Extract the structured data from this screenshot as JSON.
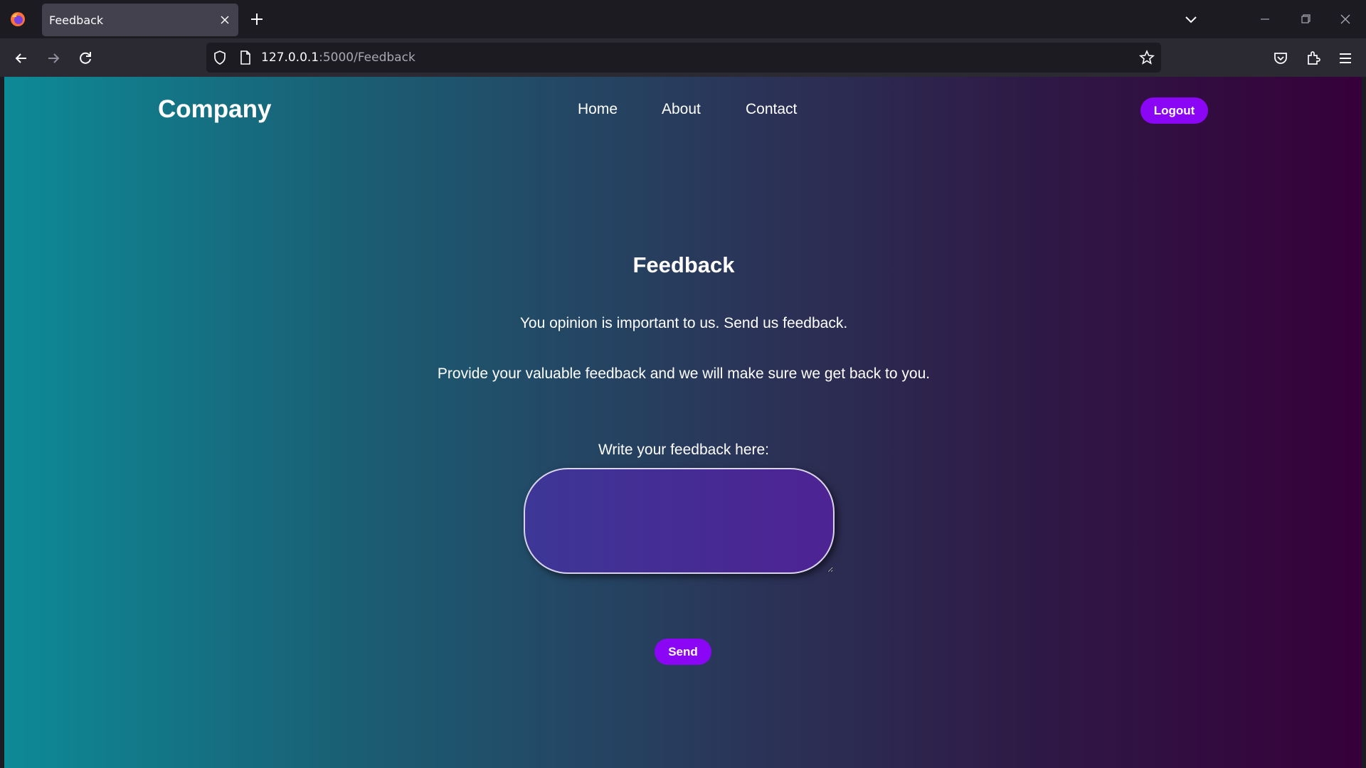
{
  "browser": {
    "tab_title": "Feedback",
    "url_host": "127.0.0.1",
    "url_path": ":5000/Feedback"
  },
  "page": {
    "brand": "Company",
    "nav": [
      "Home",
      "About",
      "Contact"
    ],
    "logout_label": "Logout",
    "title": "Feedback",
    "paragraph_1": "You opinion is important to us. Send us feedback.",
    "paragraph_2": "Provide your valuable feedback and we will make sure we get back to you.",
    "feedback_label": "Write your feedback here:",
    "feedback_value": "",
    "send_label": "Send"
  },
  "colors": {
    "accent": "#8a06f5",
    "gradient_start": "#0d8a97",
    "gradient_end": "#36003a"
  }
}
